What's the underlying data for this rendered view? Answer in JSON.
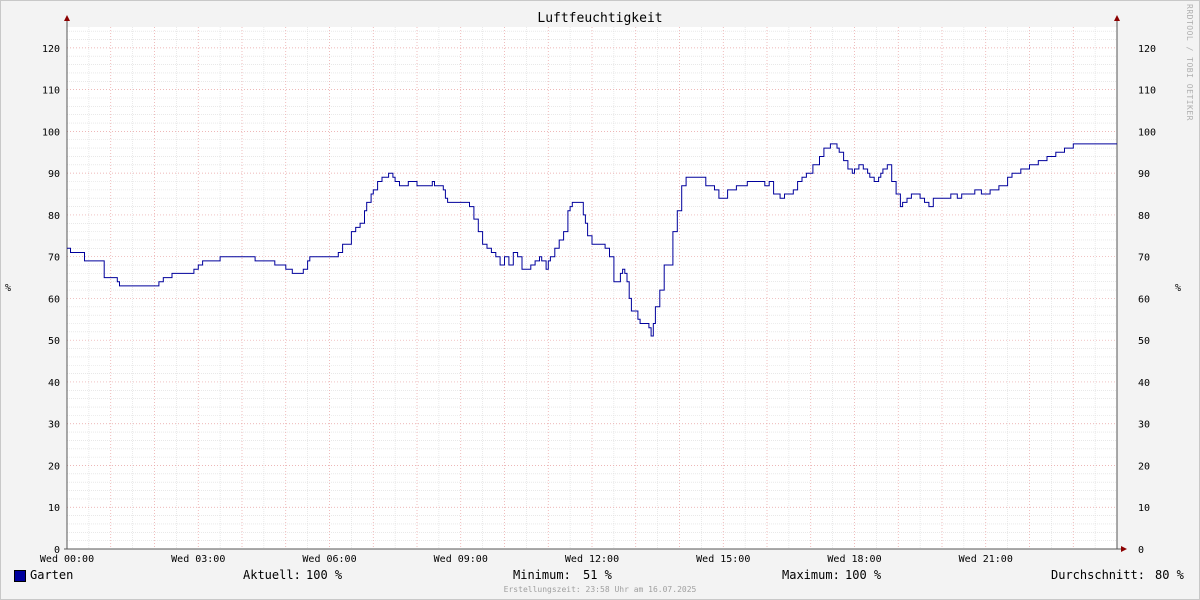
{
  "title": "Luftfeuchtigkeit",
  "watermark": "RRDTOOL / TOBI OETIKER",
  "unit_label": "%",
  "legend": {
    "series_name": "Garten",
    "current_label": "Aktuell:",
    "current_value": "100 %",
    "min_label": "Minimum:",
    "min_value": "51 %",
    "max_label": "Maximum:",
    "max_value": "100 %",
    "avg_label": "Durchschnitt:",
    "avg_value": "80 %"
  },
  "footer": "Erstellungszeit: 23:58 Uhr am 16.07.2025",
  "colors": {
    "series": "#00009c",
    "major_grid": "#e8a0a0",
    "minor_grid": "#dcdcdc",
    "axis": "#8b0000"
  },
  "chart_data": {
    "type": "line",
    "title": "Luftfeuchtigkeit",
    "xlabel": "",
    "ylabel": "%",
    "ylim": [
      0,
      125
    ],
    "xlim_hours": [
      0,
      24
    ],
    "x_tick_labels": [
      "Wed 00:00",
      "Wed 03:00",
      "Wed 06:00",
      "Wed 09:00",
      "Wed 12:00",
      "Wed 15:00",
      "Wed 18:00",
      "Wed 21:00"
    ],
    "y_ticks": [
      0,
      10,
      20,
      30,
      40,
      50,
      60,
      70,
      80,
      90,
      100,
      110,
      120
    ],
    "grid": true,
    "series": [
      {
        "name": "Garten",
        "x_hours": [
          0.0,
          0.08,
          0.37,
          0.4,
          0.8,
          0.85,
          1.1,
          1.15,
          1.2,
          1.3,
          2.0,
          2.1,
          2.2,
          2.35,
          2.4,
          2.6,
          2.9,
          3.0,
          3.1,
          3.2,
          3.45,
          3.5,
          3.7,
          3.9,
          4.3,
          4.4,
          4.6,
          4.75,
          4.8,
          5.0,
          5.05,
          5.15,
          5.3,
          5.4,
          5.5,
          5.55,
          6.1,
          6.2,
          6.3,
          6.5,
          6.55,
          6.6,
          6.7,
          6.8,
          6.85,
          6.95,
          7.0,
          7.1,
          7.2,
          7.3,
          7.35,
          7.45,
          7.5,
          7.55,
          7.6,
          7.7,
          7.8,
          8.0,
          8.2,
          8.3,
          8.35,
          8.4,
          8.5,
          8.6,
          8.65,
          8.7,
          8.9,
          9.0,
          9.1,
          9.2,
          9.3,
          9.4,
          9.5,
          9.6,
          9.7,
          9.8,
          9.9,
          10.0,
          10.1,
          10.2,
          10.3,
          10.4,
          10.6,
          10.7,
          10.8,
          10.85,
          10.95,
          11.0,
          11.05,
          11.15,
          11.25,
          11.35,
          11.45,
          11.5,
          11.55,
          11.7,
          11.8,
          11.85,
          11.9,
          12.0,
          12.05,
          12.2,
          12.3,
          12.4,
          12.5,
          12.6,
          12.65,
          12.7,
          12.75,
          12.8,
          12.85,
          12.9,
          13.05,
          13.1,
          13.2,
          13.3,
          13.35,
          13.4,
          13.45,
          13.55,
          13.65,
          13.85,
          13.95,
          14.05,
          14.15,
          14.25,
          14.5,
          14.6,
          14.8,
          14.9,
          15.0,
          15.1,
          15.3,
          15.55,
          15.6,
          15.65,
          15.75,
          15.85,
          15.95,
          16.05,
          16.15,
          16.3,
          16.4,
          16.5,
          16.6,
          16.7,
          16.8,
          16.9,
          17.05,
          17.2,
          17.3,
          17.35,
          17.45,
          17.55,
          17.6,
          17.65,
          17.75,
          17.85,
          17.95,
          18.0,
          18.1,
          18.2,
          18.3,
          18.35,
          18.4,
          18.45,
          18.5,
          18.55,
          18.6,
          18.65,
          18.75,
          18.85,
          18.95,
          19.05,
          19.1,
          19.2,
          19.3,
          19.4,
          19.5,
          19.6,
          19.7,
          19.8,
          19.9,
          20.1,
          20.2,
          20.35,
          20.45,
          20.6,
          20.75,
          20.9,
          21.1,
          21.3,
          21.5,
          21.6,
          21.8,
          22.0,
          22.2,
          22.4,
          22.6,
          22.8,
          23.0,
          23.2,
          23.4,
          23.6,
          24.0
        ],
        "values": [
          72,
          71,
          71,
          69,
          69,
          65,
          65,
          64,
          63,
          63,
          63,
          64,
          65,
          65,
          66,
          66,
          67,
          68,
          69,
          69,
          69,
          70,
          70,
          70,
          69,
          69,
          69,
          68,
          68,
          67,
          67,
          66,
          66,
          67,
          69,
          70,
          70,
          71,
          73,
          76,
          76,
          77,
          78,
          81,
          83,
          85,
          86,
          88,
          89,
          89,
          90,
          89,
          88,
          88,
          87,
          87,
          88,
          87,
          87,
          87,
          88,
          87,
          87,
          86,
          84,
          83,
          83,
          83,
          83,
          82,
          79,
          76,
          73,
          72,
          71,
          70,
          68,
          70,
          68,
          71,
          70,
          67,
          68,
          69,
          70,
          69,
          67,
          69,
          70,
          72,
          74,
          76,
          81,
          82,
          83,
          83,
          80,
          78,
          75,
          73,
          73,
          73,
          72,
          70,
          64,
          64,
          66,
          67,
          66,
          64,
          60,
          57,
          55,
          54,
          54,
          53,
          51,
          54,
          58,
          62,
          68,
          76,
          81,
          87,
          89,
          89,
          89,
          87,
          86,
          84,
          84,
          86,
          87,
          88,
          88,
          88,
          88,
          88,
          87,
          88,
          85,
          84,
          85,
          85,
          86,
          88,
          89,
          90,
          92,
          94,
          96,
          96,
          97,
          97,
          96,
          95,
          93,
          91,
          90,
          91,
          92,
          91,
          90,
          89,
          89,
          88,
          88,
          89,
          90,
          91,
          92,
          88,
          85,
          82,
          83,
          84,
          85,
          85,
          84,
          83,
          82,
          84,
          84,
          84,
          85,
          84,
          85,
          85,
          86,
          85,
          86,
          87,
          89,
          90,
          91,
          92,
          93,
          94,
          95,
          96,
          97,
          97,
          97,
          97,
          97,
          97,
          97,
          98,
          99,
          100,
          100
        ]
      }
    ]
  }
}
